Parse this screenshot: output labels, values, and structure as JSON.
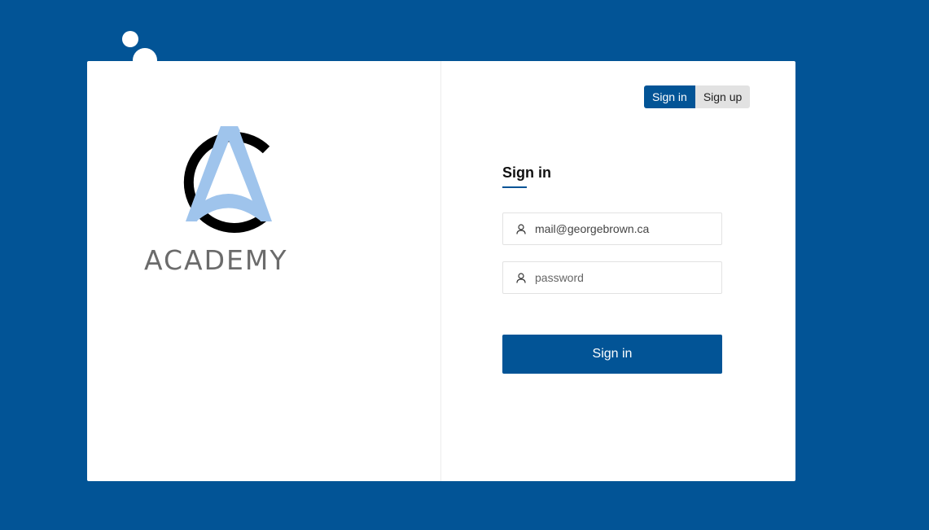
{
  "brand": {
    "name": "ACADEMY",
    "logo_icon": "academy-ca-logo",
    "colors": {
      "primary": "#025496",
      "logo_light": "#9fc4ec",
      "logo_dark": "#000000",
      "wordmark": "#6b6b6b"
    }
  },
  "tabs": {
    "signin_label": "Sign in",
    "signup_label": "Sign up",
    "active": "signin"
  },
  "form": {
    "title": "Sign in",
    "email": {
      "value": "mail@georgebrown.ca",
      "placeholder": "",
      "icon": "user-icon"
    },
    "password": {
      "value": "",
      "placeholder": "password",
      "icon": "user-icon"
    },
    "submit_label": "Sign in"
  }
}
